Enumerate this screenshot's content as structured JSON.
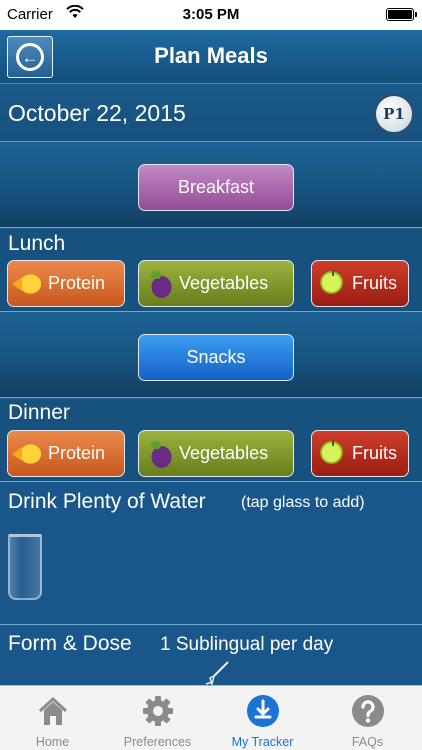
{
  "status_bar": {
    "carrier": "Carrier",
    "time": "3:05 PM"
  },
  "nav": {
    "title": "Plan Meals",
    "back_icon": "back-arrow-icon"
  },
  "date": {
    "text": "October 22, 2015",
    "badge": "P1"
  },
  "breakfast": {
    "label": "Breakfast"
  },
  "lunch": {
    "label": "Lunch",
    "buttons": [
      {
        "label": "Protein",
        "icon": "fish-icon"
      },
      {
        "label": "Vegetables",
        "icon": "eggplant-icon"
      },
      {
        "label": "Fruits",
        "icon": "apple-icon"
      }
    ]
  },
  "snacks": {
    "label": "Snacks"
  },
  "dinner": {
    "label": "Dinner",
    "buttons": [
      {
        "label": "Protein",
        "icon": "fish-icon"
      },
      {
        "label": "Vegetables",
        "icon": "eggplant-icon"
      },
      {
        "label": "Fruits",
        "icon": "apple-icon"
      }
    ]
  },
  "water": {
    "title": "Drink Plenty of Water",
    "hint": "(tap glass to add)"
  },
  "dose": {
    "title": "Form & Dose",
    "value": "1 Sublingual per day"
  },
  "tabs": [
    {
      "label": "Home",
      "icon": "home-icon",
      "active": false
    },
    {
      "label": "Preferences",
      "icon": "gear-icon",
      "active": false
    },
    {
      "label": "My Tracker",
      "icon": "tracker-icon",
      "active": true
    },
    {
      "label": "FAQs",
      "icon": "question-icon",
      "active": false
    }
  ],
  "colors": {
    "background": "#1c5f8f",
    "breakfast": "#a866ab",
    "snacks": "#2a7fdc",
    "protein": "#d96e33",
    "vegetables": "#82992c",
    "fruits": "#b52c1e",
    "tab_active": "#1a74d2",
    "tab_inactive": "#8b8b8b"
  }
}
